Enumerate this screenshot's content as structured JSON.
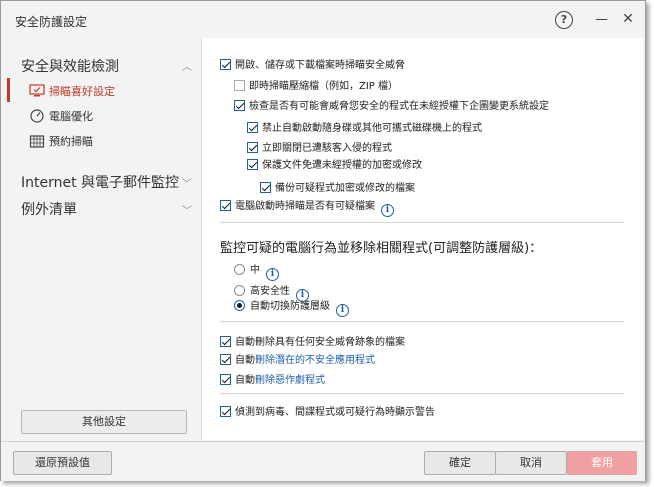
{
  "window": {
    "title": "安全防護設定"
  },
  "sidebar": {
    "categories": [
      {
        "label": "安全與效能檢測",
        "expanded": true
      },
      {
        "label": "Internet 與電子郵件監控",
        "expanded": false
      },
      {
        "label": "例外清單",
        "expanded": false
      }
    ],
    "items": [
      {
        "label": "掃瞄喜好設定",
        "icon": "monitor-check-icon",
        "active": true
      },
      {
        "label": "電腦優化",
        "icon": "gauge-icon",
        "active": false
      },
      {
        "label": "預約掃瞄",
        "icon": "calendar-icon",
        "active": false
      }
    ],
    "other_settings_label": "其他設定"
  },
  "options": {
    "scan_on_open": {
      "label": "開啟、儲存或下載檔案時掃瞄安全威脅",
      "checked": true
    },
    "scan_zip": {
      "label": "即時掃瞄壓縮檔（例如，ZIP 檔）",
      "checked": false
    },
    "check_unauthorized": {
      "label": "檢查是否有可能會威脅您安全的程式在未經授權下企圖變更系統設定",
      "checked": true
    },
    "block_autorun": {
      "label": "禁止自動啟動隨身碟或其他可攜式磁碟機上的程式",
      "checked": true
    },
    "close_malware": {
      "label": "立即關閉已遭駭客入侵的程式",
      "checked": true
    },
    "protect_docs": {
      "label": "保護文件免遭未經授權的加密或修改",
      "checked": true
    },
    "backup_docs": {
      "label": "備份可疑程式加密或修改的檔案",
      "checked": true
    },
    "scan_on_boot": {
      "label": "電腦啟動時掃瞄是否有可疑檔案",
      "checked": true
    }
  },
  "behavior_section": {
    "title": "監控可疑的電腦行為並移除相關程式(可調整防護層級)：",
    "levels": [
      {
        "label": "中",
        "selected": false
      },
      {
        "label": "高安全性",
        "selected": false
      },
      {
        "label": "自動切換防護層級",
        "selected": true
      }
    ]
  },
  "auto_delete": {
    "files": {
      "label": "自動刪除具有任何安全威脅跡象的檔案",
      "checked": true
    },
    "pua_prefix": "自動",
    "pua_link": "刪除潛在的不安全應用程式",
    "pua_checked": true,
    "joke_prefix": "自動",
    "joke_link": "刪除惡作劇程式",
    "joke_checked": true
  },
  "warning": {
    "label": "偵測到病毒、間諜程式或可疑行為時顯示警告",
    "checked": true
  },
  "buttons": {
    "restore_label": "還原預設值",
    "ok_label": "確定",
    "cancel_label": "取消",
    "apply_label": "套用"
  },
  "colors": {
    "accent": "#c0392b",
    "link": "#1f5ea8",
    "apply_disabled": "#f0a0a0"
  }
}
